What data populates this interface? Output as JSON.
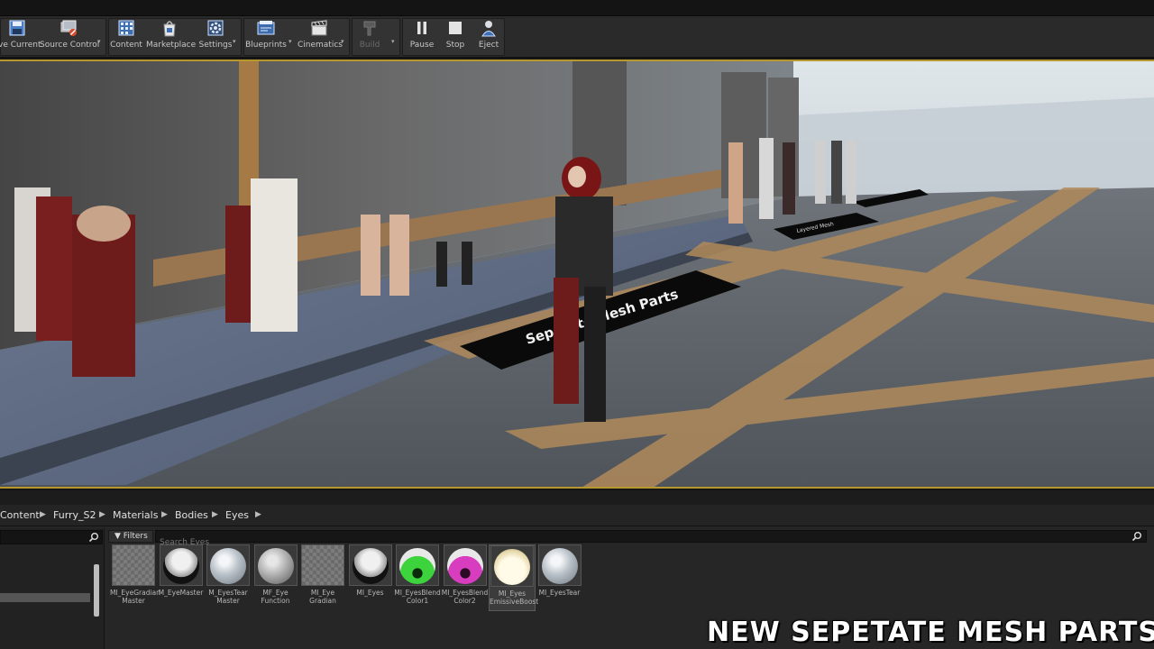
{
  "toolbar": {
    "buttons": [
      {
        "id": "save",
        "label": "ve Current"
      },
      {
        "id": "source",
        "label": "Source Control"
      },
      {
        "id": "content",
        "label": "Content"
      },
      {
        "id": "marketplace",
        "label": "Marketplace"
      },
      {
        "id": "settings",
        "label": "Settings"
      },
      {
        "id": "blueprints",
        "label": "Blueprints"
      },
      {
        "id": "cinematics",
        "label": "Cinematics"
      },
      {
        "id": "build",
        "label": "Build"
      },
      {
        "id": "pause",
        "label": "Pause"
      },
      {
        "id": "stop",
        "label": "Stop"
      },
      {
        "id": "eject",
        "label": "Eject"
      }
    ]
  },
  "viewport": {
    "floor_sign_main": "Sepetate Mesh Parts",
    "floor_sign_small": "Layered Mesh"
  },
  "browser": {
    "breadcrumb": [
      "Content",
      "Furry_S2",
      "Materials",
      "Bodies",
      "Eyes"
    ],
    "filters_label": "Filters",
    "search_placeholder": "Search Eyes",
    "assets": [
      {
        "name": "MI_EyeGradian\nMaster",
        "thumb": "checker",
        "sphere": "none"
      },
      {
        "name": "M_EyeMaster",
        "thumb": "dark",
        "sphere": "eye-dark"
      },
      {
        "name": "M_EyesTear\nMaster",
        "thumb": "dark",
        "sphere": "glass"
      },
      {
        "name": "MF_Eye\nFunction",
        "thumb": "dark",
        "sphere": "grey"
      },
      {
        "name": "MI_Eye\nGradian",
        "thumb": "checker",
        "sphere": "none"
      },
      {
        "name": "MI_Eyes",
        "thumb": "dark",
        "sphere": "eye-dark"
      },
      {
        "name": "MI_EyesBlend\nColor1",
        "thumb": "dark",
        "sphere": "green"
      },
      {
        "name": "MI_EyesBlend\nColor2",
        "thumb": "dark",
        "sphere": "pink"
      },
      {
        "name": "MI_Eyes\nEmissiveBoost",
        "thumb": "dark",
        "sphere": "cream",
        "selected": true
      },
      {
        "name": "MI_EyesTear",
        "thumb": "dark",
        "sphere": "glass"
      }
    ]
  },
  "banner": {
    "text": "NEW SEPETATE MESH PARTS"
  },
  "colors": {
    "accent": "#b6982f",
    "toolbar_bg": "#2a2a2a",
    "panel_bg": "#262626"
  }
}
